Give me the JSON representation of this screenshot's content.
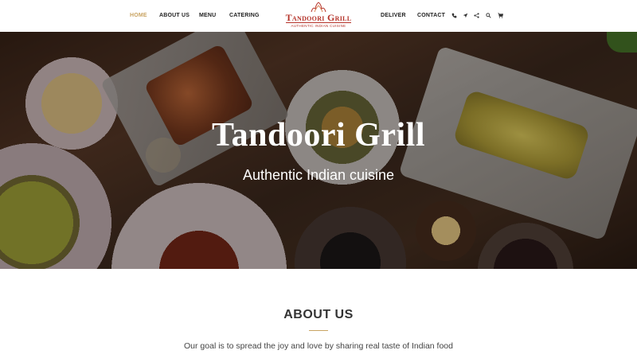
{
  "nav": {
    "left": [
      {
        "label": "HOME",
        "active": true
      },
      {
        "label": "ABOUT US"
      },
      {
        "label": "MENU"
      },
      {
        "label": "CATERING"
      }
    ],
    "right": [
      {
        "label": "DELIVER"
      },
      {
        "label": "CONTACT"
      }
    ],
    "icons": [
      "phone-icon",
      "location-arrow-icon",
      "share-icon",
      "search-icon",
      "cart-icon"
    ],
    "active_color": "#c9a463"
  },
  "logo": {
    "name": "Tandoori Grill",
    "tagline": "AUTHENTIC INDIAN CUISINE",
    "color": "#b5332a"
  },
  "hero": {
    "title": "Tandoori Grill",
    "subtitle": "Authentic Indian cuisine"
  },
  "about": {
    "title": "ABOUT US",
    "text": "Our goal is to spread the joy and love by sharing real taste of Indian food",
    "accent": "#c9a463"
  }
}
